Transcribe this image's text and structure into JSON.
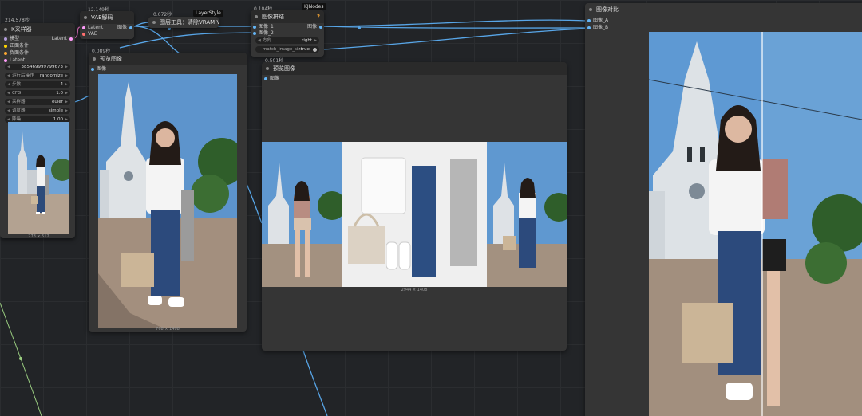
{
  "nodes": {
    "ksampler": {
      "time": "214.578秒",
      "title": "K采样器",
      "inputs": [
        "模型",
        "正面条件",
        "负面条件",
        "Latent"
      ],
      "output": "Latent",
      "widgets": [
        {
          "label": "",
          "value": "385469999799673"
        },
        {
          "label": "运行后操作",
          "value": "randomize"
        },
        {
          "label": "步数",
          "value": "4"
        },
        {
          "label": "CFG",
          "value": "1.0"
        },
        {
          "label": "采样器",
          "value": "euler"
        },
        {
          "label": "调度器",
          "value": "simple"
        },
        {
          "label": "降噪",
          "value": "1.00"
        }
      ],
      "dims": "278 × 512"
    },
    "vae_decode": {
      "time": "12.149秒",
      "title": "VAE解码",
      "inputs": [
        "Latent",
        "VAE"
      ],
      "output": "图像"
    },
    "layerstyle": {
      "time": "0.072秒",
      "badge": "LayerStyle",
      "title": "图层工具：清除VRAM V2"
    },
    "image_stitch": {
      "time": "0.104秒",
      "badge": "KJNodes",
      "badge_icon": "?",
      "title": "图像拼结",
      "inputs": [
        "图像_1",
        "图像_2"
      ],
      "output": "图像",
      "widgets": [
        {
          "label": "方向",
          "value": "right"
        },
        {
          "label": "match_image_size",
          "value": "true"
        }
      ]
    },
    "preview1": {
      "time": "0.089秒",
      "title": "预览图像",
      "input": "图像",
      "dims": "768 × 1408"
    },
    "preview2": {
      "time": "0.501秒",
      "title": "预览图像",
      "input": "图像",
      "dims": "2944 × 1408"
    },
    "compare": {
      "title": "图像对比",
      "inputs": [
        "图像_A",
        "图像_B"
      ]
    }
  },
  "colors": {
    "canvas": "#222427",
    "node_body": "#353535",
    "node_header": "#2a2a2a",
    "link_blue": "#58a6e8",
    "link_pink": "#e070c0",
    "link_green": "#9acd80",
    "slot_latent": "#ff9cf9",
    "slot_model": "#b39ddb",
    "slot_cond_pos": "#ffd500",
    "slot_cond_neg": "#ffa931",
    "slot_image": "#64b5f6",
    "slot_vae": "#ff6e6e"
  }
}
